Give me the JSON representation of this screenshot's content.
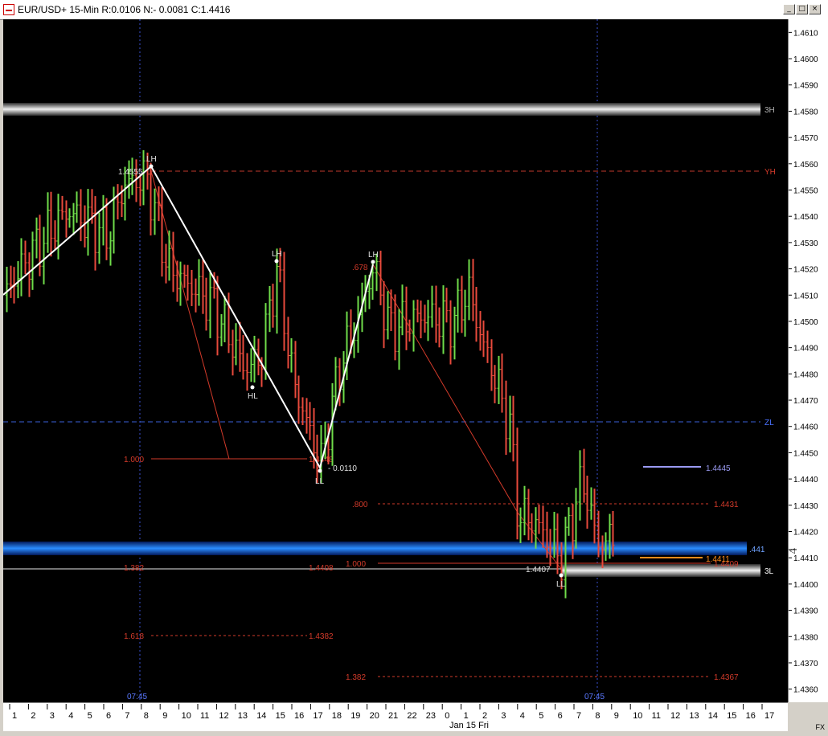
{
  "window": {
    "title": "EUR/USD+ 15-Min R:0.0106 N:- 0.0081 C:1.4416",
    "buttons": [
      "_",
      "□",
      "×"
    ]
  },
  "price_axis": {
    "ticks": [
      "1.4610",
      "1.4600",
      "1.4590",
      "1.4580",
      "1.4570",
      "1.4560",
      "1.4550",
      "1.4540",
      "1.4530",
      "1.4520",
      "1.4510",
      "1.4500",
      "1.4490",
      "1.4480",
      "1.4470",
      "1.4460",
      "1.4450",
      "1.4440",
      "1.4430",
      "1.4420",
      "1.4410",
      "1.4400",
      "1.4390",
      "1.4380",
      "1.4370",
      "1.4360"
    ],
    "current_marker": "1.441",
    "corner_label": "FX"
  },
  "time_axis": {
    "hours": [
      "1",
      "2",
      "3",
      "4",
      "5",
      "6",
      "7",
      "8",
      "9",
      "10",
      "11",
      "12",
      "13",
      "14",
      "15",
      "16",
      "17",
      "18",
      "19",
      "20",
      "21",
      "22",
      "23",
      "0",
      "1",
      "2",
      "3",
      "4",
      "5",
      "6",
      "7",
      "8",
      "9",
      "10",
      "11",
      "12",
      "13",
      "14",
      "15",
      "16",
      "17"
    ],
    "date_label": "Jan 15 Fri",
    "session_marks": [
      "07:45",
      "07:45"
    ]
  },
  "levels": {
    "three_h": "3H",
    "yh": "YH",
    "zl": "ZL",
    "three_l": "3L",
    "current": ".441"
  },
  "pivots": {
    "lh1": "LH",
    "lh1_price": "1.4555",
    "lh2": "LH",
    "hl": "HL",
    "ll1": "LL",
    "ll1_range": "- 0.0110",
    "lh3": "LH",
    "lh3_ratio": ".678",
    "ll2": "LL",
    "ll2_price": "1.4407"
  },
  "fibs": {
    "f1_ratio": "1.000",
    "f1_price": "1.4448",
    "f2_ratio": "1.382",
    "f2_price": "1.4408",
    "f3_ratio": "1.618",
    "f3_price": "1.4382",
    "f4_ratio": ".800",
    "f4_price": "1.4431",
    "f5_ratio": "1.000",
    "f5_price": "1.4409",
    "f6_ratio": "1.382",
    "f6_price": "1.4367"
  },
  "markers": {
    "m1": "1.4445",
    "m2": "1.4411"
  },
  "colors": {
    "up_bar": "#6fdc4a",
    "down_bar": "#e84a3c",
    "zone_blue": "#1e6fff",
    "fib_red": "#d23a2a",
    "zl_blue": "#3a5fd8",
    "lavender": "#9a9af2",
    "orange": "#ff8c1a"
  },
  "chart_data": {
    "type": "ohlc",
    "symbol": "EUR/USD+",
    "interval": "15-Min",
    "ylim": [
      1.4355,
      1.4615
    ],
    "pivots": [
      {
        "label": "LH",
        "price": 1.4555
      },
      {
        "label": "LH",
        "price": 1.4521
      },
      {
        "label": "HL",
        "price": 1.4477
      },
      {
        "label": "LL",
        "price": 1.4445
      },
      {
        "label": "LH",
        "price": 1.4521
      },
      {
        "label": "LL",
        "price": 1.4407
      }
    ],
    "levels": [
      {
        "label": "3H",
        "price": 1.4579
      },
      {
        "label": "YH",
        "price": 1.4555
      },
      {
        "label": "ZL",
        "price": 1.4462
      },
      {
        "label": "3L",
        "price": 1.4408
      },
      {
        "label": ".441",
        "price": 1.4416
      }
    ],
    "fib_levels": [
      {
        "ratio": "1.000",
        "price": 1.4448
      },
      {
        "ratio": "1.382",
        "price": 1.4408
      },
      {
        "ratio": "1.618",
        "price": 1.4382
      },
      {
        "ratio": ".800",
        "price": 1.4431
      },
      {
        "ratio": "1.000",
        "price": 1.4409
      },
      {
        "ratio": "1.382",
        "price": 1.4367
      }
    ],
    "close_price": 1.4416
  }
}
